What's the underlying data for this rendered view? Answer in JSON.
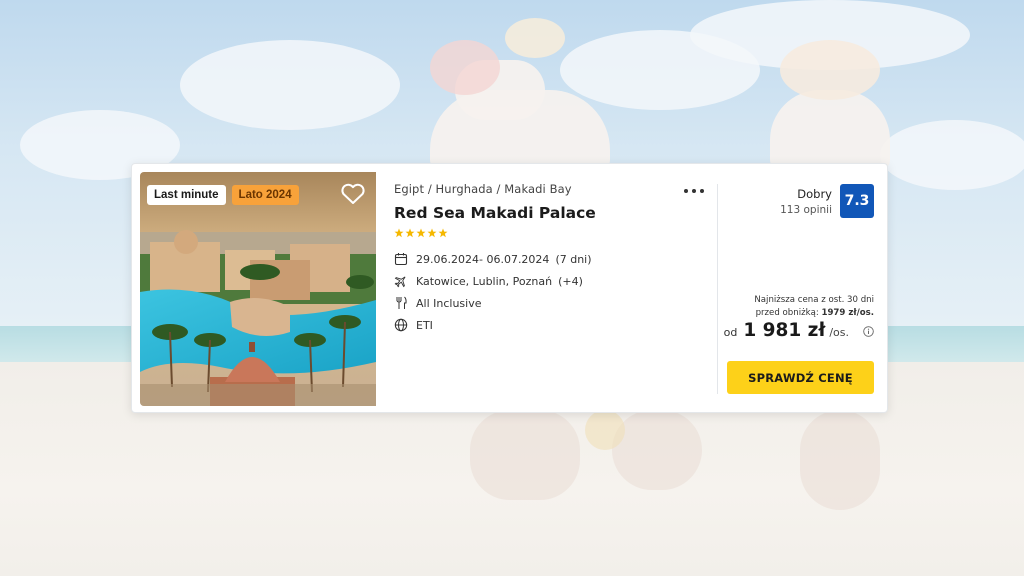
{
  "badges": [
    "Last minute",
    "Lato 2024"
  ],
  "offer": {
    "breadcrumb": "Egipt / Hurghada / Makadi Bay",
    "title": "Red Sea Makadi Palace",
    "stars": 5,
    "dates": "29.06.2024- 06.07.2024",
    "duration": "(7 dni)",
    "departures": "Katowice, Lublin, Poznań",
    "departures_more": "(+4)",
    "board": "All Inclusive",
    "operator": "ETI"
  },
  "rating": {
    "label": "Dobry",
    "count": "113 opinii",
    "score": "7.3"
  },
  "pricing": {
    "lowest_line1": "Najniższa cena z ost. 30 dni",
    "lowest_line2_prefix": "przed obniżką:",
    "lowest_line2_value": "1979 zł/os.",
    "from": "od",
    "amount": "1 981 zł",
    "unit": "/os."
  },
  "cta_label": "SPRAWDŹ CENĘ",
  "colors": {
    "cta": "#fdd119",
    "score_bg": "#1157b8",
    "badge_orange": "#f8a23a",
    "star": "#f5b800"
  },
  "icons": {
    "favorite": "heart-icon",
    "more": "more-dots-icon",
    "dates": "calendar-icon",
    "departures": "plane-icon",
    "board": "cutlery-icon",
    "operator": "globe-icon",
    "price_info": "info-icon"
  }
}
